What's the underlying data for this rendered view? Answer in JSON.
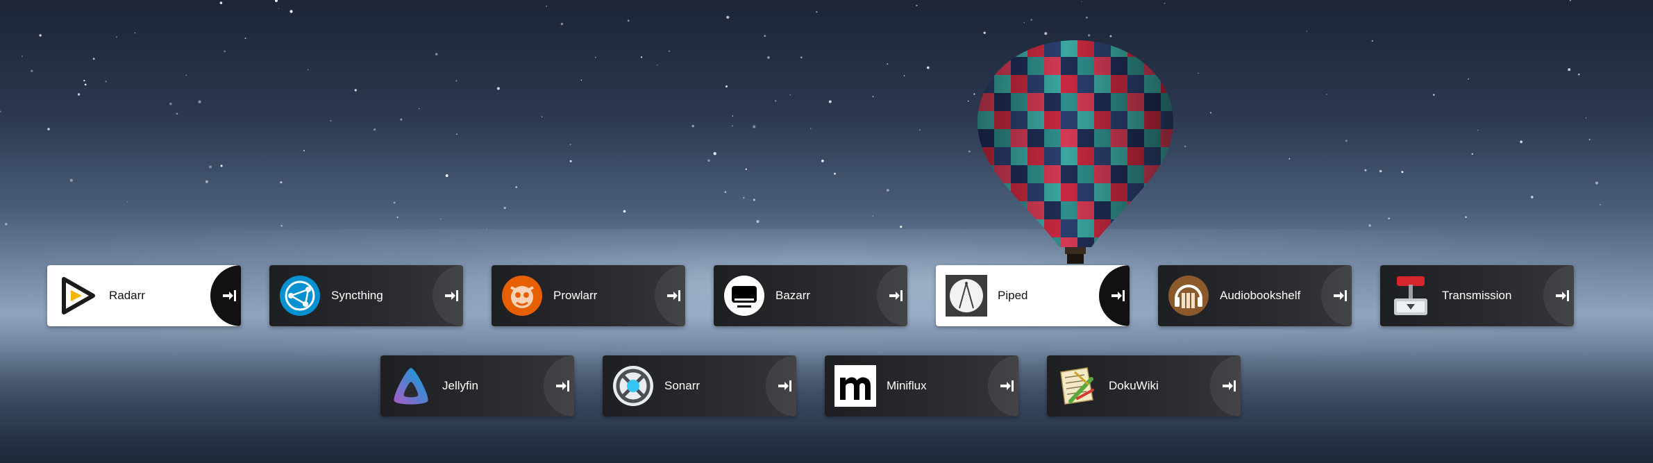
{
  "background": {
    "scene": "night-sky-balloon-over-water",
    "sky_color": "#1d2536",
    "horizon_color": "#8ea3bd"
  },
  "tiles": [
    {
      "id": "radarr",
      "name": "Radarr",
      "icon": "radarr-icon",
      "theme": "light"
    },
    {
      "id": "syncthing",
      "name": "Syncthing",
      "icon": "syncthing-icon",
      "theme": "dark"
    },
    {
      "id": "prowlarr",
      "name": "Prowlarr",
      "icon": "prowlarr-icon",
      "theme": "dark"
    },
    {
      "id": "bazarr",
      "name": "Bazarr",
      "icon": "bazarr-icon",
      "theme": "dark"
    },
    {
      "id": "piped",
      "name": "Piped",
      "icon": "piped-icon",
      "theme": "light"
    },
    {
      "id": "audiobookshelf",
      "name": "Audiobookshelf",
      "icon": "audiobookshelf-icon",
      "theme": "dark"
    },
    {
      "id": "transmission",
      "name": "Transmission",
      "icon": "transmission-icon",
      "theme": "dark"
    },
    {
      "id": "jellyfin",
      "name": "Jellyfin",
      "icon": "jellyfin-icon",
      "theme": "dark"
    },
    {
      "id": "sonarr",
      "name": "Sonarr",
      "icon": "sonarr-icon",
      "theme": "dark"
    },
    {
      "id": "miniflux",
      "name": "Miniflux",
      "icon": "miniflux-icon",
      "theme": "dark"
    },
    {
      "id": "dokuwiki",
      "name": "DokuWiki",
      "icon": "dokuwiki-icon",
      "theme": "dark"
    }
  ],
  "launch_icon": "launch-arrow-icon",
  "colors": {
    "tile_dark": "#2a2b2e",
    "tile_light": "#ffffff",
    "text_dark_tile": "#ffffff",
    "text_light_tile": "#111111"
  }
}
